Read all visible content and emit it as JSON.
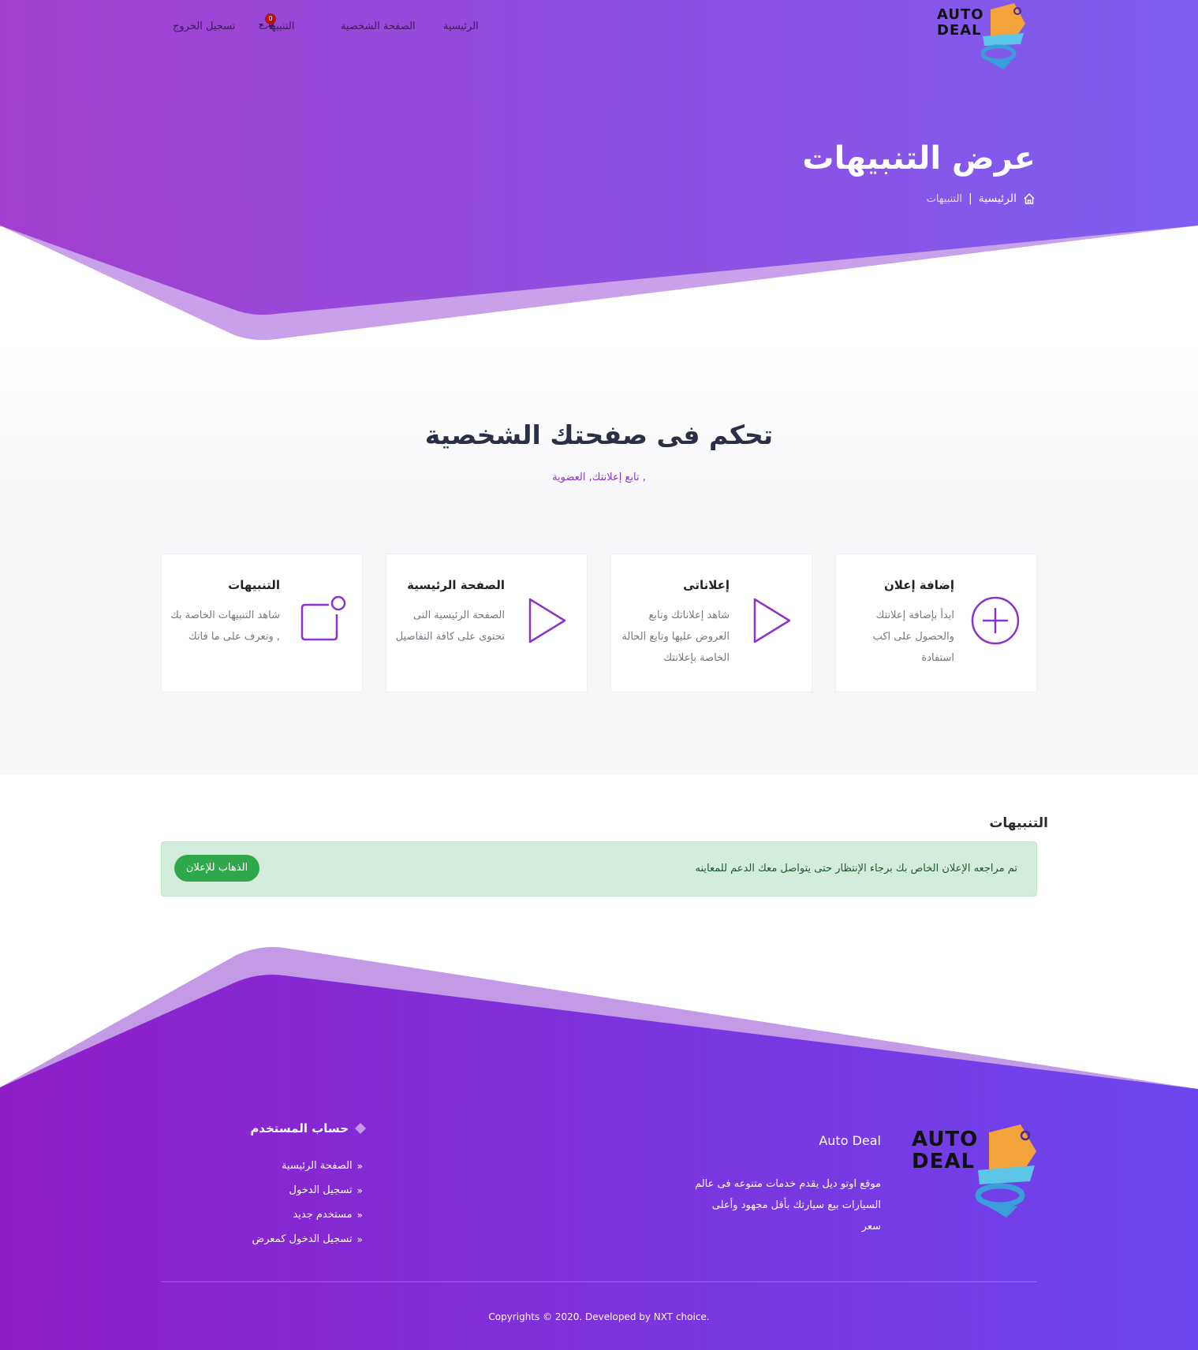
{
  "colors": {
    "hero_gradient_start": "#a23fcf",
    "hero_gradient_end": "#7d5ef0",
    "hero_ribbon": "#c9a0ea",
    "footer_gradient_start": "#8f1ec8",
    "footer_gradient_end": "#6c46ee",
    "accent_purple": "#8a34c9",
    "alert_bg": "#d4ecdb",
    "button_green": "#2ea84a"
  },
  "logo": {
    "line1": "AUTO",
    "line2": "DEAL"
  },
  "nav": {
    "home": "الرئيسية",
    "profile": "الصفحة الشخصية",
    "notifications": "التنبيهات",
    "notifications_count": "0",
    "logout": "تسجيل الخروج"
  },
  "hero": {
    "title": "عرض التنبيهات",
    "breadcrumb_home": "الرئيسية",
    "breadcrumb_separator": "|",
    "breadcrumb_current": "التنبيهات"
  },
  "control": {
    "title": "تحكم فى صفحتك الشخصية",
    "subtitle": ", تابع إعلانتك, العضوية",
    "cards": [
      {
        "title": "إضافة إعلان",
        "text": "ابدأ بإضافة إعلانتك والحصول على اكب استفادة",
        "icon": "plus-circle-icon"
      },
      {
        "title": "إعلاناتى",
        "text": "شاهد إعلاناتك وتابع العروض عليها وتابع الحالة الخاصة بإعلانتك",
        "icon": "play-icon"
      },
      {
        "title": "الصفحة الرئيسية",
        "text": "الصفحة الرئيسية التى تحتوى على كافة التفاصيل",
        "icon": "play-icon"
      },
      {
        "title": "التنبيهات",
        "text": "شاهد التنبيهات الخاصة بك , وتعرف على ما فاتك",
        "icon": "notification-square-icon"
      }
    ]
  },
  "notifications": {
    "heading": "التنبيهات",
    "items": [
      {
        "message": "تم مراجعه الإعلان الخاص بك برجاء الإنتظار حتى يتواصل معك الدعم للمعاينه",
        "button": "الذهاب للإعلان"
      }
    ]
  },
  "footer": {
    "brand": "Auto Deal",
    "about": "موقع اوتو ديل يقدم خدمات متنوعه فى عالم السيارات بيع سيارتك بأقل مجهود وأعلى سعر",
    "account_title": "حساب المستخدم",
    "links": [
      "الصفحة الرئيسية",
      "تسجيل الدخول",
      "مستخدم جديد",
      "تسجيل الدخول كمعرض"
    ],
    "copyright": "Copyrights © 2020. Developed by NXT choice."
  }
}
